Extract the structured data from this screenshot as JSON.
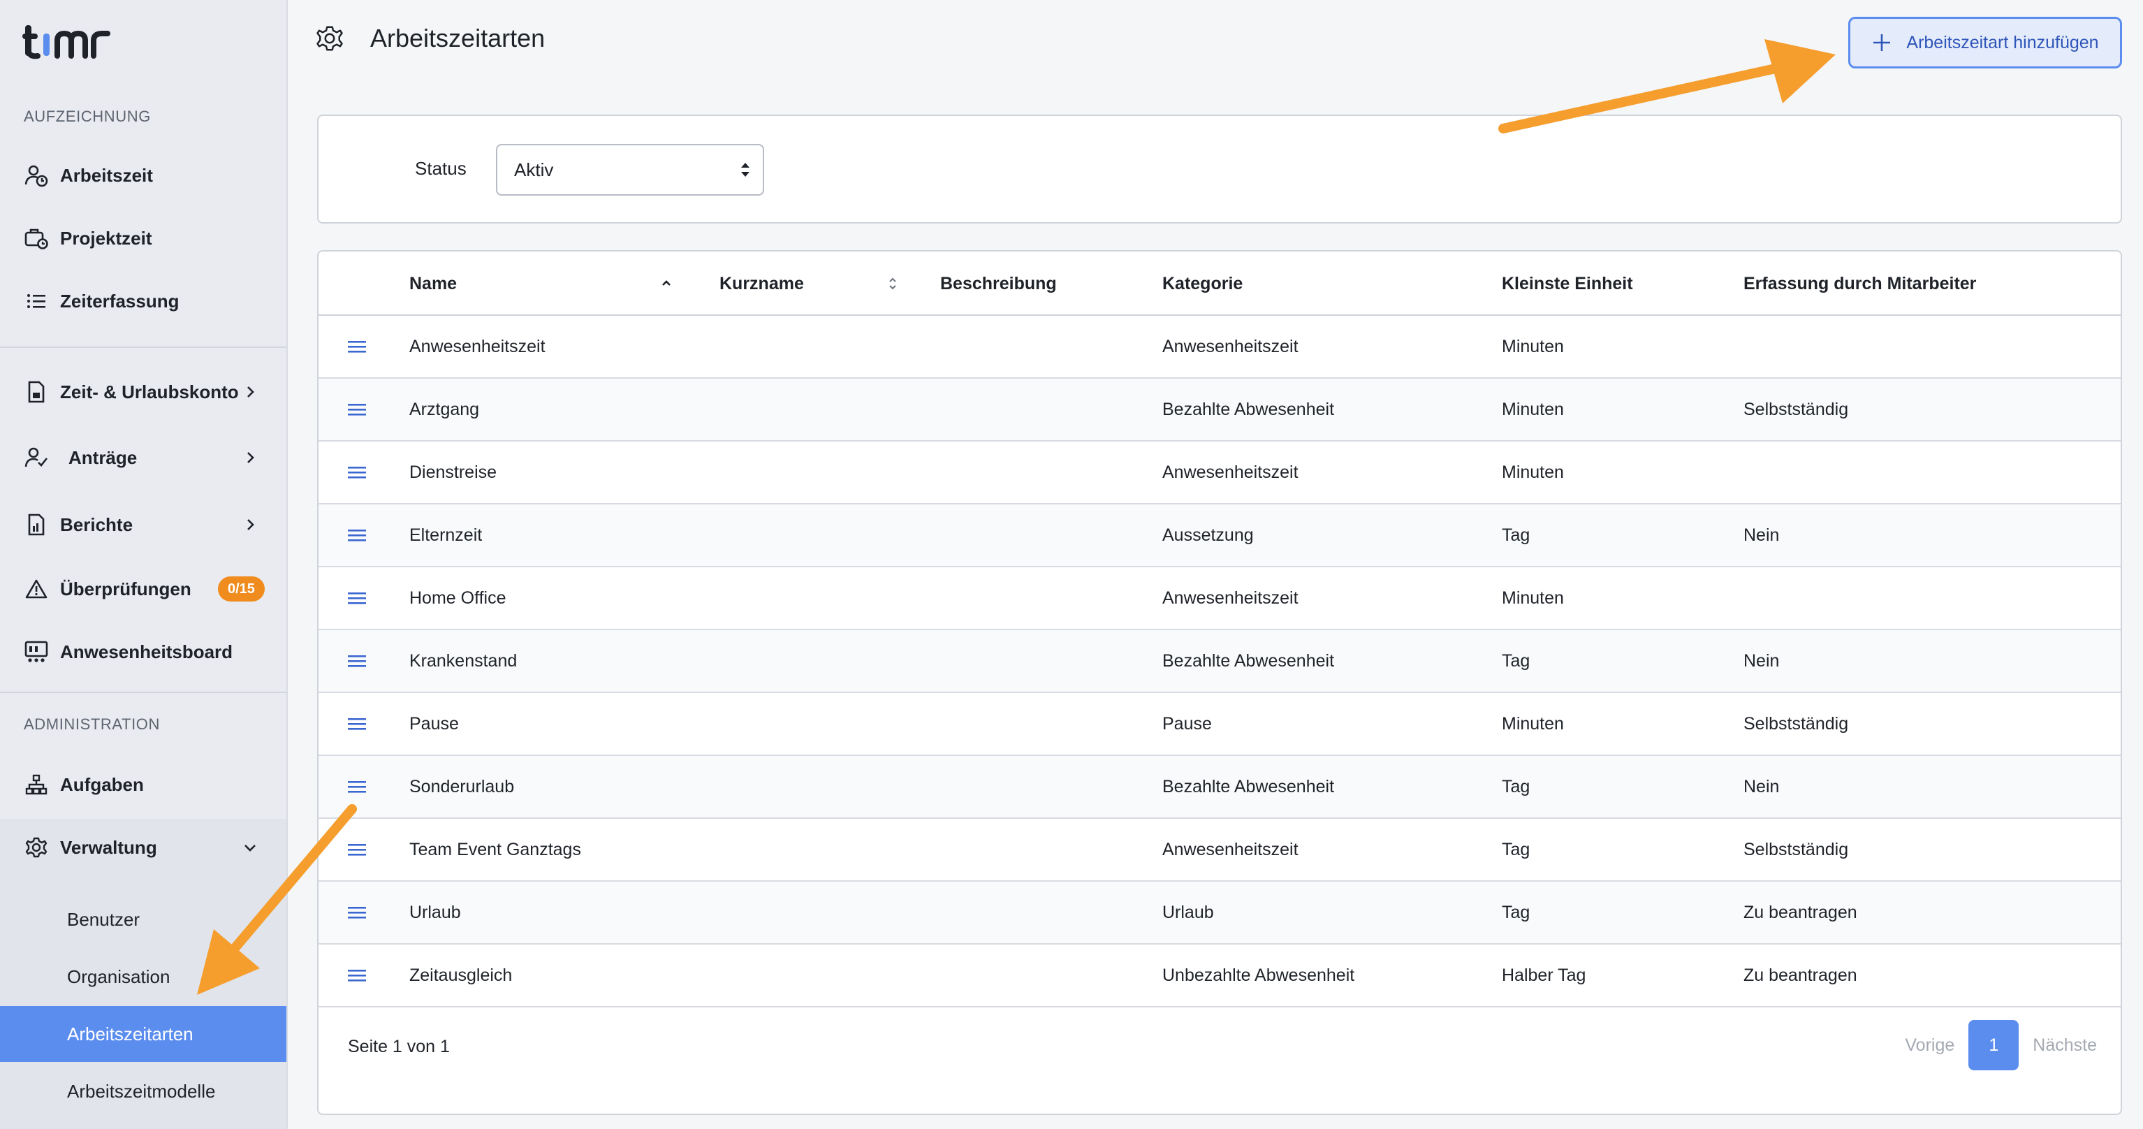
{
  "app": {
    "logo_text": "timr"
  },
  "sidebar": {
    "section_recording": "AUFZEICHNUNG",
    "section_admin": "ADMINISTRATION",
    "items": [
      {
        "label": "Arbeitszeit",
        "icon": "user-clock-icon"
      },
      {
        "label": "Projektzeit",
        "icon": "briefcase-clock-icon"
      },
      {
        "label": "Zeiterfassung",
        "icon": "list-icon"
      },
      {
        "label": "Zeit- & Urlaubskonto",
        "icon": "document-icon"
      },
      {
        "label": "Anträge",
        "icon": "user-check-icon"
      },
      {
        "label": "Berichte",
        "icon": "report-icon"
      },
      {
        "label": "Überprüfungen",
        "icon": "warning-icon",
        "badge": "0/15"
      },
      {
        "label": "Anwesenheitsboard",
        "icon": "presence-board-icon"
      },
      {
        "label": "Aufgaben",
        "icon": "hierarchy-icon"
      },
      {
        "label": "Verwaltung",
        "icon": "gear-icon"
      }
    ],
    "sub_items": [
      {
        "label": "Benutzer"
      },
      {
        "label": "Organisation"
      },
      {
        "label": "Arbeitszeitarten",
        "active": true
      },
      {
        "label": "Arbeitszeitmodelle"
      }
    ]
  },
  "header": {
    "title": "Arbeitszeitarten",
    "add_button_label": "Arbeitszeitart hinzufügen"
  },
  "filter": {
    "status_label": "Status",
    "status_value": "Aktiv"
  },
  "table": {
    "columns": {
      "name": "Name",
      "kurzname": "Kurzname",
      "beschreibung": "Beschreibung",
      "kategorie": "Kategorie",
      "einheit": "Kleinste Einheit",
      "erfassung": "Erfassung durch Mitarbeiter"
    },
    "rows": [
      {
        "name": "Anwesenheitszeit",
        "kurzname": "",
        "beschreibung": "",
        "kategorie": "Anwesenheitszeit",
        "einheit": "Minuten",
        "erfassung": ""
      },
      {
        "name": "Arztgang",
        "kurzname": "",
        "beschreibung": "",
        "kategorie": "Bezahlte Abwesenheit",
        "einheit": "Minuten",
        "erfassung": "Selbstständig"
      },
      {
        "name": "Dienstreise",
        "kurzname": "",
        "beschreibung": "",
        "kategorie": "Anwesenheitszeit",
        "einheit": "Minuten",
        "erfassung": ""
      },
      {
        "name": "Elternzeit",
        "kurzname": "",
        "beschreibung": "",
        "kategorie": "Aussetzung",
        "einheit": "Tag",
        "erfassung": "Nein"
      },
      {
        "name": "Home Office",
        "kurzname": "",
        "beschreibung": "",
        "kategorie": "Anwesenheitszeit",
        "einheit": "Minuten",
        "erfassung": ""
      },
      {
        "name": "Krankenstand",
        "kurzname": "",
        "beschreibung": "",
        "kategorie": "Bezahlte Abwesenheit",
        "einheit": "Tag",
        "erfassung": "Nein"
      },
      {
        "name": "Pause",
        "kurzname": "",
        "beschreibung": "",
        "kategorie": "Pause",
        "einheit": "Minuten",
        "erfassung": "Selbstständig"
      },
      {
        "name": "Sonderurlaub",
        "kurzname": "",
        "beschreibung": "",
        "kategorie": "Bezahlte Abwesenheit",
        "einheit": "Tag",
        "erfassung": "Nein"
      },
      {
        "name": "Team Event Ganztags",
        "kurzname": "",
        "beschreibung": "",
        "kategorie": "Anwesenheitszeit",
        "einheit": "Tag",
        "erfassung": "Selbstständig"
      },
      {
        "name": "Urlaub",
        "kurzname": "",
        "beschreibung": "",
        "kategorie": "Urlaub",
        "einheit": "Tag",
        "erfassung": "Zu beantragen"
      },
      {
        "name": "Zeitausgleich",
        "kurzname": "",
        "beschreibung": "",
        "kategorie": "Unbezahlte Abwesenheit",
        "einheit": "Halber Tag",
        "erfassung": "Zu beantragen"
      }
    ]
  },
  "pagination": {
    "page_text": "Seite 1 von 1",
    "prev_label": "Vorige",
    "current_page": "1",
    "next_label": "Nächste"
  },
  "colors": {
    "accent": "#5b8def",
    "badge": "#f08c1e",
    "annotation_arrow": "#f59e2e"
  }
}
